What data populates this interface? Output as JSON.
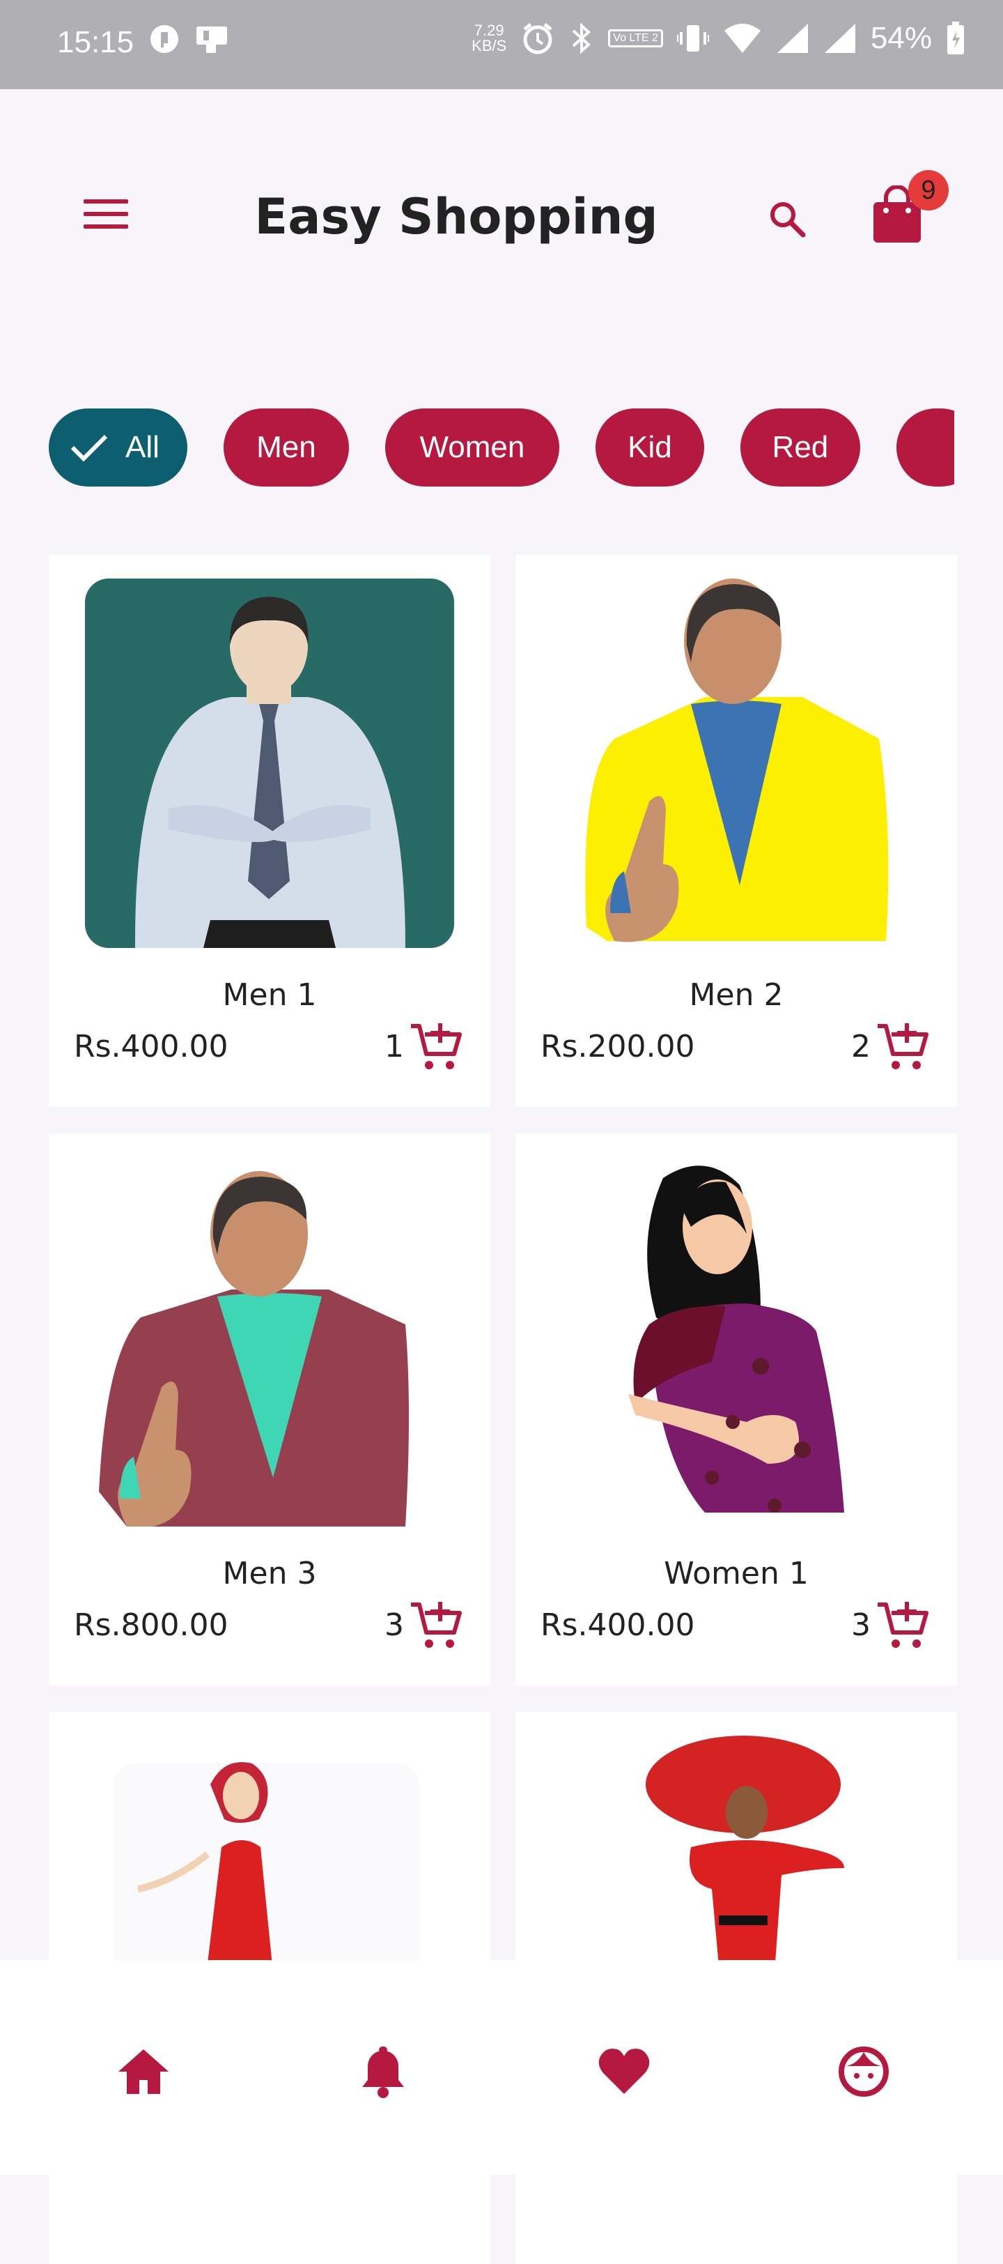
{
  "status_bar": {
    "time": "15:15",
    "speed_value": "7.29",
    "speed_unit": "KB/S",
    "network_label": "Vo LTE 2",
    "battery": "54%"
  },
  "app_bar": {
    "title": "Easy Shopping",
    "cart_count": "9"
  },
  "filters": [
    {
      "label": "All",
      "selected": true
    },
    {
      "label": "Men",
      "selected": false
    },
    {
      "label": "Women",
      "selected": false
    },
    {
      "label": "Kid",
      "selected": false
    },
    {
      "label": "Red",
      "selected": false
    }
  ],
  "products": [
    {
      "name": "Men 1",
      "price": "Rs.400.00",
      "qty": "1"
    },
    {
      "name": "Men 2",
      "price": "Rs.200.00",
      "qty": "2"
    },
    {
      "name": "Men 3",
      "price": "Rs.800.00",
      "qty": "3"
    },
    {
      "name": "Women 1",
      "price": "Rs.400.00",
      "qty": "3"
    },
    {
      "name": "",
      "price": "",
      "qty": ""
    },
    {
      "name": "",
      "price": "",
      "qty": ""
    }
  ],
  "colors": {
    "accent": "#b5193f",
    "chip_selected": "#0d5f6f",
    "badge": "#e63b3b",
    "background": "#f7f5f9"
  },
  "icons": {
    "menu": "menu-icon",
    "search": "search-icon",
    "cart": "shopping-bag-icon",
    "add_to_cart": "add-cart-icon",
    "home": "home-icon",
    "notifications": "bell-icon",
    "favorites": "heart-icon",
    "profile": "face-icon"
  }
}
